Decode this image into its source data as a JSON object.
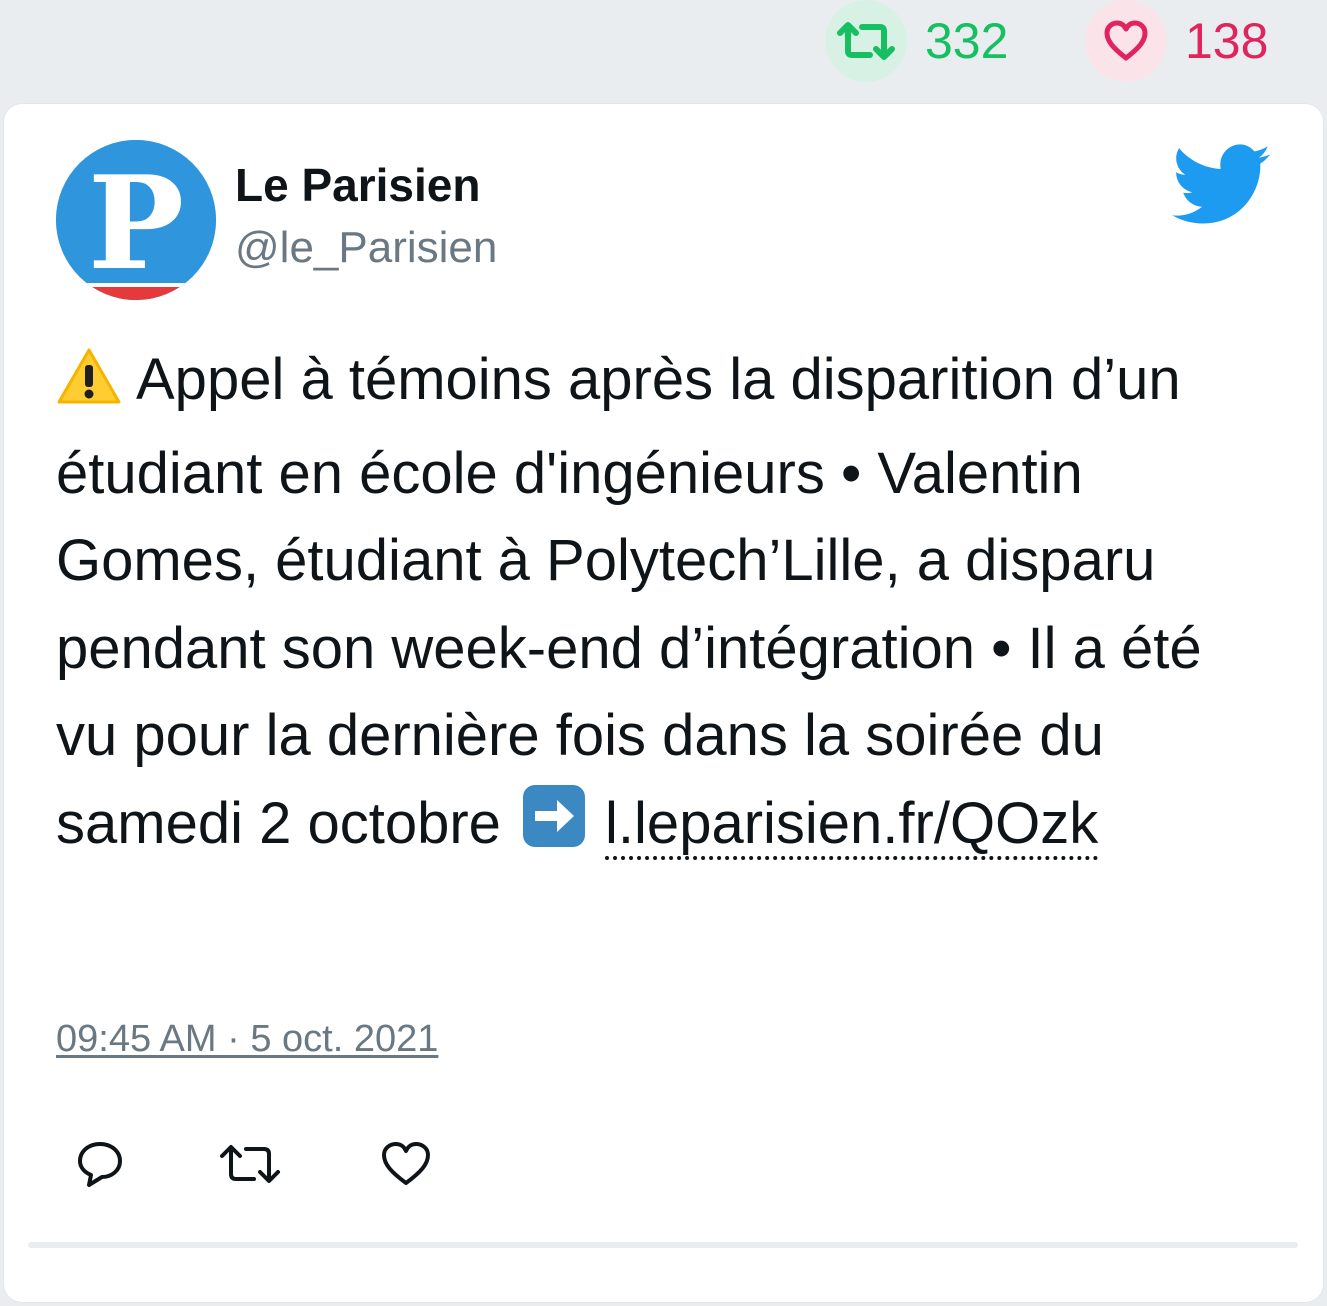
{
  "stats": {
    "retweet_count": "332",
    "like_count": "138"
  },
  "author": {
    "name": "Le Parisien",
    "handle": "@le_Parisien",
    "avatar_letter": "P"
  },
  "tweet": {
    "text_line_1": "Appel à témoins après la disparition d’un étudiant en école d'ingénieurs • Valentin Gomes, étudiant à Polytech’Lille, a disparu pendant son week-end d’intégration • Il a été vu pour la dernière fois dans la soirée du samedi 2 octobre",
    "link": "l.leparisien.fr/QOzk",
    "timestamp": "09:45 AM · 5 oct. 2021"
  },
  "icons": {
    "leading_emoji": "warning-icon",
    "link_emoji": "right-arrow-icon",
    "brand": "twitter-bird-icon",
    "actions": [
      "reply-icon",
      "retweet-icon",
      "like-icon"
    ]
  },
  "colors": {
    "retweet": "#17bf63",
    "like": "#e0245e",
    "twitter_blue": "#1d9bf0",
    "muted": "#697882"
  }
}
